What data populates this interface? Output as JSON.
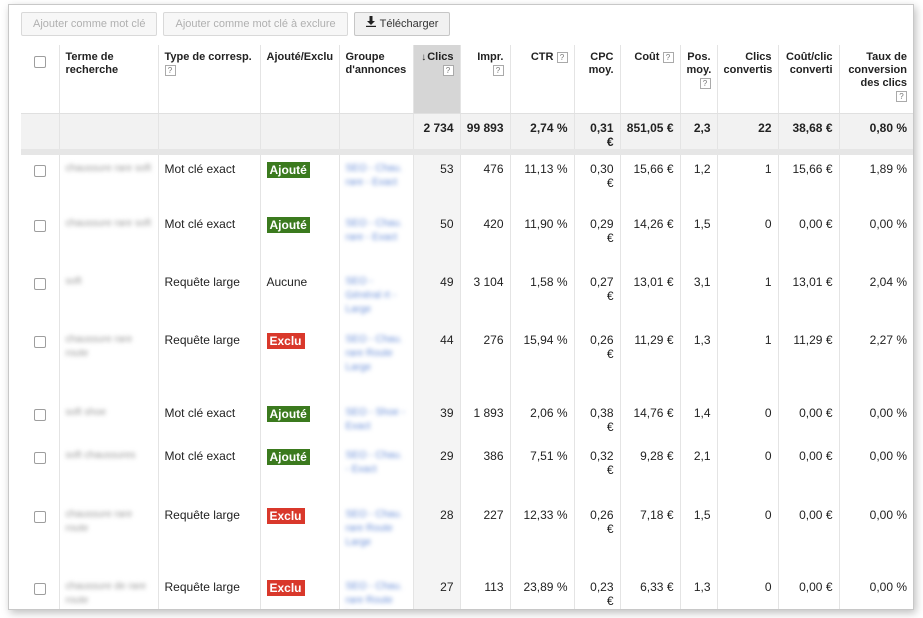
{
  "toolbar": {
    "add_keyword": "Ajouter comme mot clé",
    "add_negative": "Ajouter comme mot clé à exclure",
    "download": "Télécharger"
  },
  "columns": {
    "term": "Terme de recherche",
    "match": "Type de corresp.",
    "added": "Ajouté/Exclu",
    "group": "Groupe d'annonces",
    "clicks": "Clics",
    "impr": "Impr.",
    "ctr": "CTR",
    "cpc": "CPC moy.",
    "cost": "Coût",
    "pos": "Pos. moy.",
    "conv": "Clics convertis",
    "cpconv": "Coût/clic converti",
    "rate": "Taux de conversion des clics",
    "help": "?"
  },
  "totals": {
    "clicks": "2 734",
    "impr": "99 893",
    "ctr": "2,74 %",
    "cpc": "0,31 €",
    "cost": "851,05 €",
    "pos": "2,3",
    "conv": "22",
    "cpconv": "38,68 €",
    "rate": "0,80 %"
  },
  "rows": [
    {
      "term": "chaussure rare soft",
      "match": "Mot clé exact",
      "status": "Ajouté",
      "status_kind": "added",
      "group": "SEO - Chau. rare - Exact",
      "clicks": "53",
      "impr": "476",
      "ctr": "11,13 %",
      "cpc": "0,30 €",
      "cost": "15,66 €",
      "pos": "1,2",
      "conv": "1",
      "cpconv": "15,66 €",
      "rate": "1,89 %"
    },
    {
      "term": "chaussure rare soft",
      "match": "Mot clé exact",
      "status": "Ajouté",
      "status_kind": "added",
      "group": "SEO - Chau. rare - Exact",
      "clicks": "50",
      "impr": "420",
      "ctr": "11,90 %",
      "cpc": "0,29 €",
      "cost": "14,26 €",
      "pos": "1,5",
      "conv": "0",
      "cpconv": "0,00 €",
      "rate": "0,00 %"
    },
    {
      "term": "soft",
      "match": "Requête large",
      "status": "Aucune",
      "status_kind": "none",
      "group": "SEO - Général rt - Large",
      "clicks": "49",
      "impr": "3 104",
      "ctr": "1,58 %",
      "cpc": "0,27 €",
      "cost": "13,01 €",
      "pos": "3,1",
      "conv": "1",
      "cpconv": "13,01 €",
      "rate": "2,04 %"
    },
    {
      "term": "chaussure rare route",
      "match": "Requête large",
      "status": "Exclu",
      "status_kind": "excl",
      "group": "SEO - Chau. rare Route Large",
      "clicks": "44",
      "impr": "276",
      "ctr": "15,94 %",
      "cpc": "0,26 €",
      "cost": "11,29 €",
      "pos": "1,3",
      "conv": "1",
      "cpconv": "11,29 €",
      "rate": "2,27 %"
    },
    {
      "term": "soft shoe",
      "match": "Mot clé exact",
      "status": "Ajouté",
      "status_kind": "added",
      "group": "SEO - Shoe - Exact",
      "clicks": "39",
      "impr": "1 893",
      "ctr": "2,06 %",
      "cpc": "0,38 €",
      "cost": "14,76 €",
      "pos": "1,4",
      "conv": "0",
      "cpconv": "0,00 €",
      "rate": "0,00 %"
    },
    {
      "term": "soft chaussures",
      "match": "Mot clé exact",
      "status": "Ajouté",
      "status_kind": "added",
      "group": "SEO - Chau. - Exact",
      "clicks": "29",
      "impr": "386",
      "ctr": "7,51 %",
      "cpc": "0,32 €",
      "cost": "9,28 €",
      "pos": "2,1",
      "conv": "0",
      "cpconv": "0,00 €",
      "rate": "0,00 %"
    },
    {
      "term": "chaussure rare route",
      "match": "Requête large",
      "status": "Exclu",
      "status_kind": "excl",
      "group": "SEO - Chau. rare Route Large",
      "clicks": "28",
      "impr": "227",
      "ctr": "12,33 %",
      "cpc": "0,26 €",
      "cost": "7,18 €",
      "pos": "1,5",
      "conv": "0",
      "cpconv": "0,00 €",
      "rate": "0,00 %"
    },
    {
      "term": "chaussure de rare route",
      "match": "Requête large",
      "status": "Exclu",
      "status_kind": "excl",
      "group": "SEO - Chau. rare Route Large",
      "clicks": "27",
      "impr": "113",
      "ctr": "23,89 %",
      "cpc": "0,23 €",
      "cost": "6,33 €",
      "pos": "1,3",
      "conv": "0",
      "cpconv": "0,00 €",
      "rate": "0,00 %"
    }
  ],
  "row_heights": [
    58,
    58,
    58,
    73,
    43,
    59,
    72,
    60
  ],
  "colors": {
    "added": "#3b7a1e",
    "excluded": "#d9382b",
    "link": "#6a8fd8",
    "sorted_header": "#d6d6d6"
  }
}
